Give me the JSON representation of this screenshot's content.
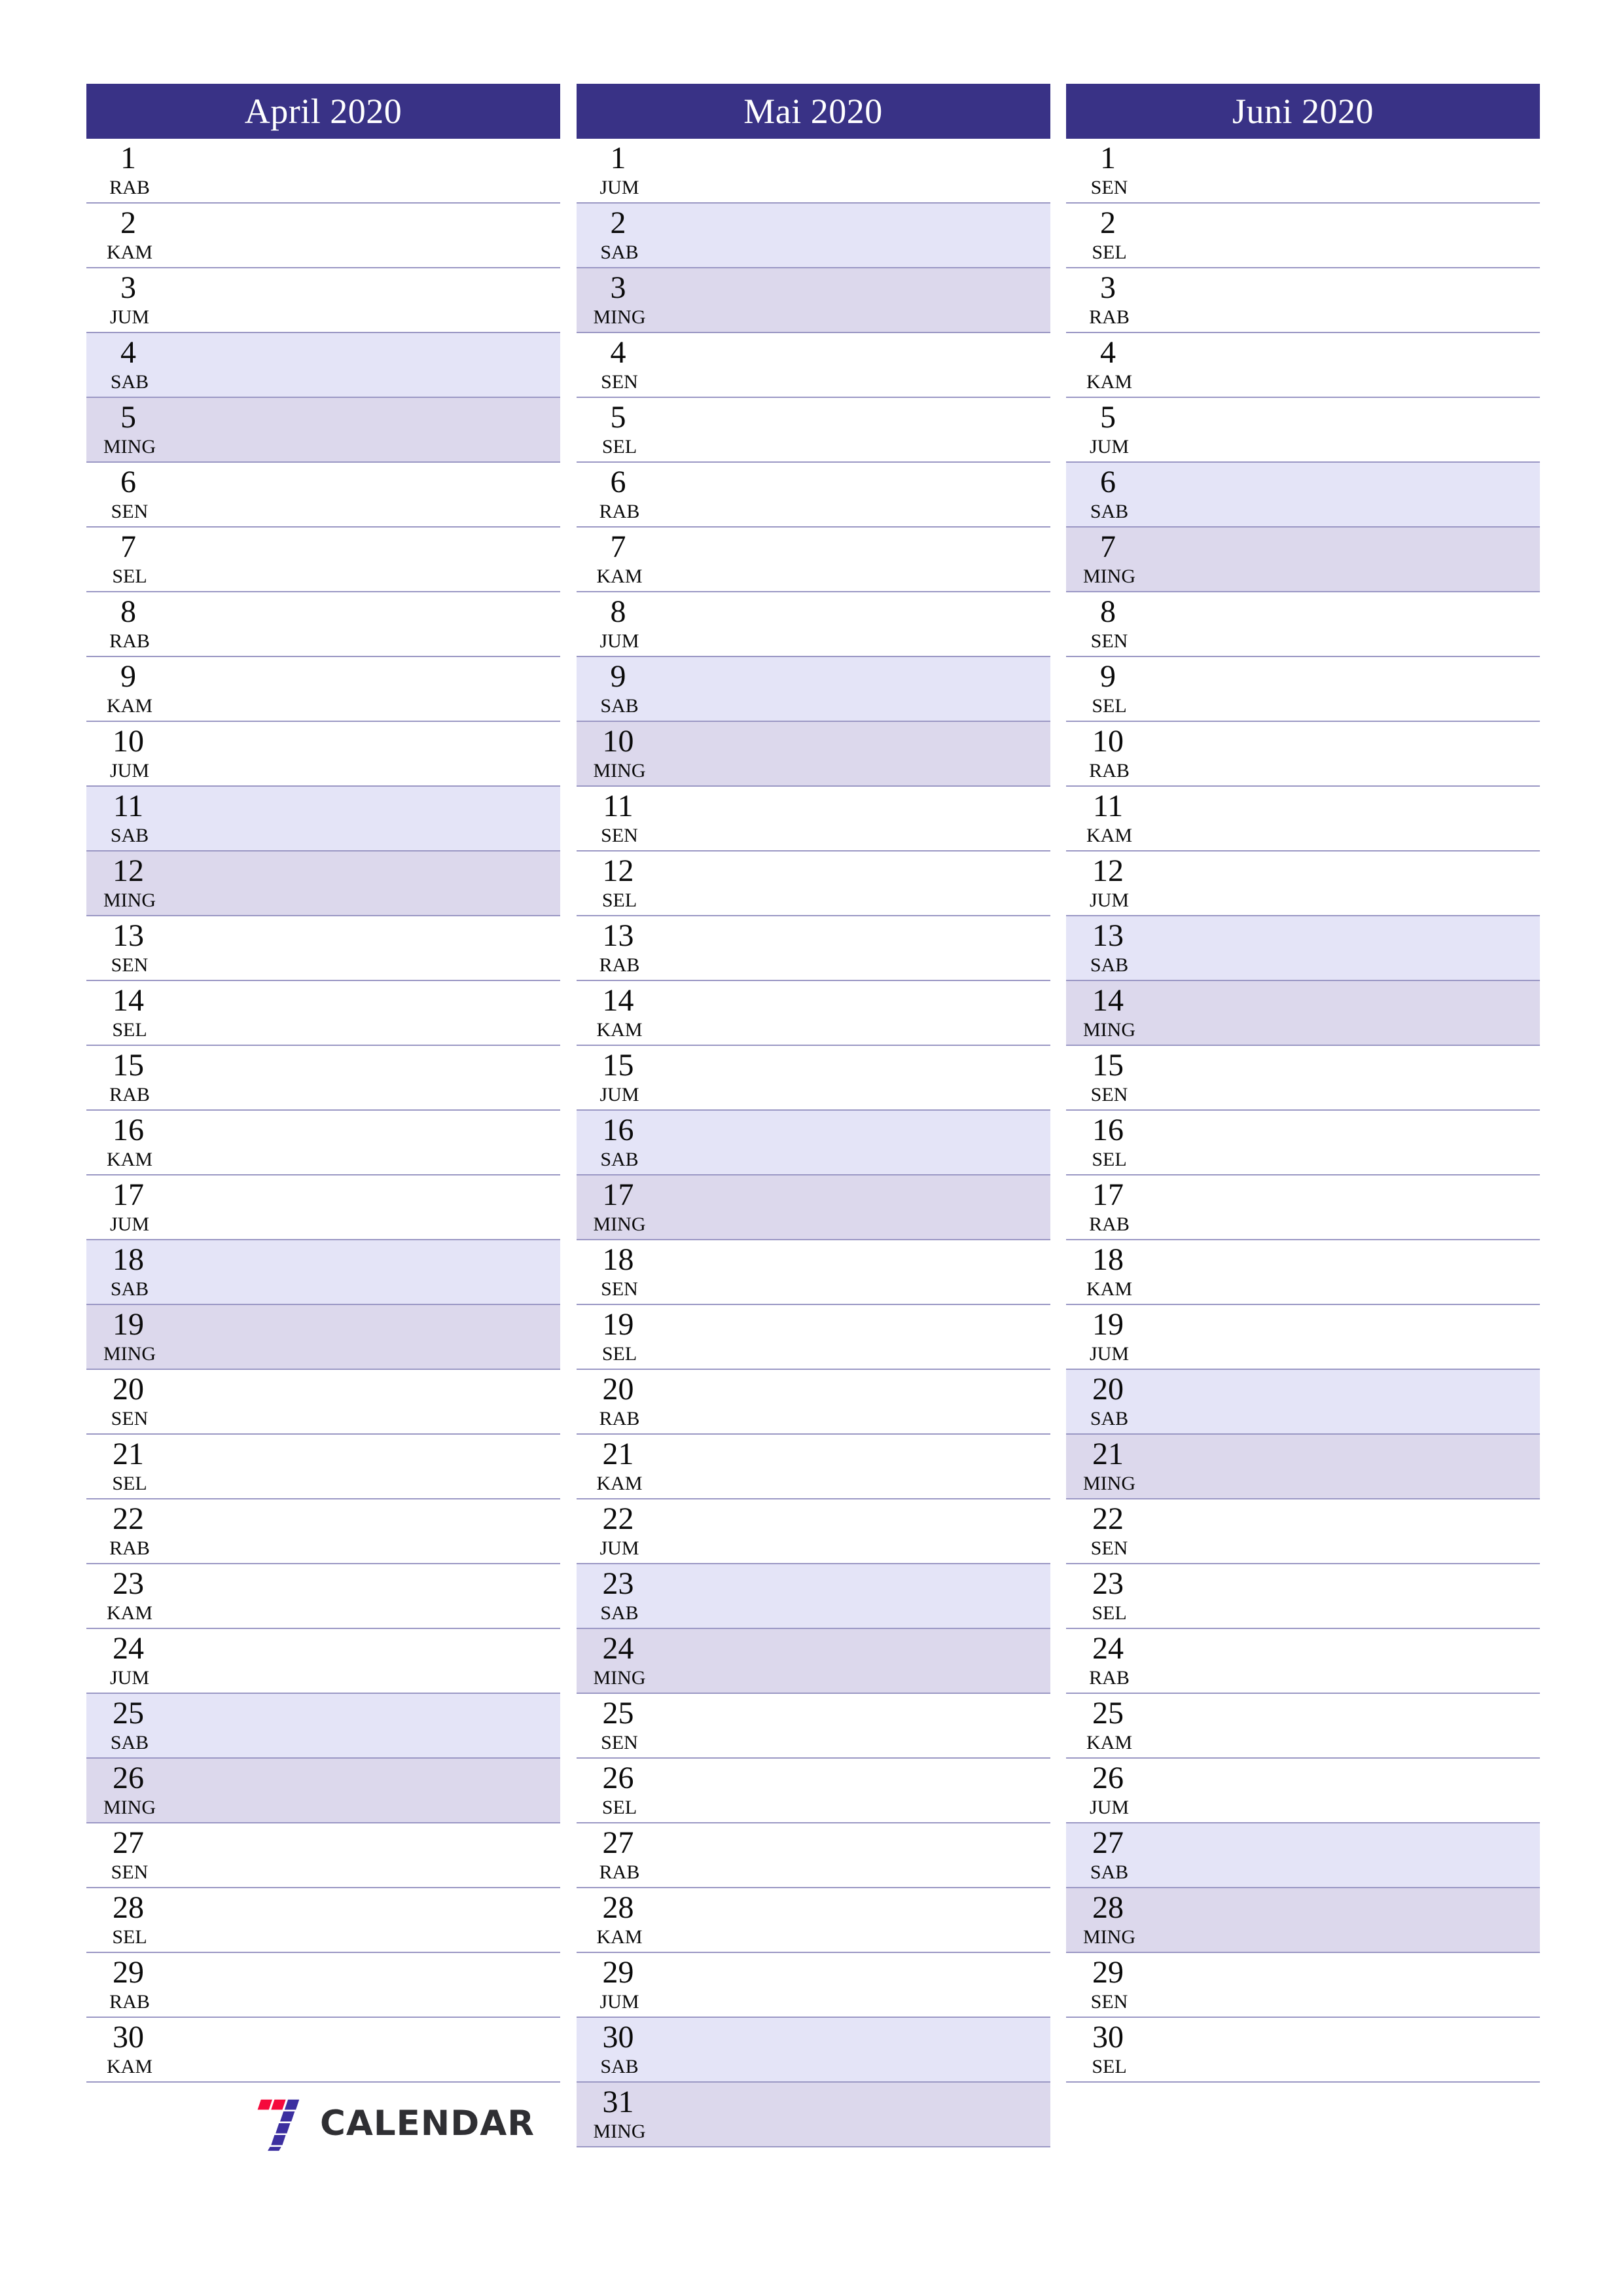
{
  "brand": {
    "name": "CALENDAR",
    "mark_icon": "seven-logo-icon",
    "mark_colors": {
      "red": "#f50a3c",
      "indigo": "#3c2fa0"
    },
    "text_color": "#2f2f33"
  },
  "theme": {
    "header_bg": "#393286",
    "header_text": "#ffffff",
    "saturday_bg": "#e4e4f7",
    "sunday_bg": "#dcd8ec",
    "row_line": "#9a97c4",
    "day_text": "#0a0a0a",
    "page_bg": "#ffffff"
  },
  "page": {
    "orientation": "portrait",
    "columns": 3,
    "locale_weekdays": [
      "SEN",
      "SEL",
      "RAB",
      "KAM",
      "JUM",
      "SAB",
      "MING"
    ]
  },
  "months": [
    {
      "title": "April 2020",
      "days": [
        {
          "num": "1",
          "dow": "RAB"
        },
        {
          "num": "2",
          "dow": "KAM"
        },
        {
          "num": "3",
          "dow": "JUM"
        },
        {
          "num": "4",
          "dow": "SAB"
        },
        {
          "num": "5",
          "dow": "MING"
        },
        {
          "num": "6",
          "dow": "SEN"
        },
        {
          "num": "7",
          "dow": "SEL"
        },
        {
          "num": "8",
          "dow": "RAB"
        },
        {
          "num": "9",
          "dow": "KAM"
        },
        {
          "num": "10",
          "dow": "JUM"
        },
        {
          "num": "11",
          "dow": "SAB"
        },
        {
          "num": "12",
          "dow": "MING"
        },
        {
          "num": "13",
          "dow": "SEN"
        },
        {
          "num": "14",
          "dow": "SEL"
        },
        {
          "num": "15",
          "dow": "RAB"
        },
        {
          "num": "16",
          "dow": "KAM"
        },
        {
          "num": "17",
          "dow": "JUM"
        },
        {
          "num": "18",
          "dow": "SAB"
        },
        {
          "num": "19",
          "dow": "MING"
        },
        {
          "num": "20",
          "dow": "SEN"
        },
        {
          "num": "21",
          "dow": "SEL"
        },
        {
          "num": "22",
          "dow": "RAB"
        },
        {
          "num": "23",
          "dow": "KAM"
        },
        {
          "num": "24",
          "dow": "JUM"
        },
        {
          "num": "25",
          "dow": "SAB"
        },
        {
          "num": "26",
          "dow": "MING"
        },
        {
          "num": "27",
          "dow": "SEN"
        },
        {
          "num": "28",
          "dow": "SEL"
        },
        {
          "num": "29",
          "dow": "RAB"
        },
        {
          "num": "30",
          "dow": "KAM"
        }
      ]
    },
    {
      "title": "Mai 2020",
      "days": [
        {
          "num": "1",
          "dow": "JUM"
        },
        {
          "num": "2",
          "dow": "SAB"
        },
        {
          "num": "3",
          "dow": "MING"
        },
        {
          "num": "4",
          "dow": "SEN"
        },
        {
          "num": "5",
          "dow": "SEL"
        },
        {
          "num": "6",
          "dow": "RAB"
        },
        {
          "num": "7",
          "dow": "KAM"
        },
        {
          "num": "8",
          "dow": "JUM"
        },
        {
          "num": "9",
          "dow": "SAB"
        },
        {
          "num": "10",
          "dow": "MING"
        },
        {
          "num": "11",
          "dow": "SEN"
        },
        {
          "num": "12",
          "dow": "SEL"
        },
        {
          "num": "13",
          "dow": "RAB"
        },
        {
          "num": "14",
          "dow": "KAM"
        },
        {
          "num": "15",
          "dow": "JUM"
        },
        {
          "num": "16",
          "dow": "SAB"
        },
        {
          "num": "17",
          "dow": "MING"
        },
        {
          "num": "18",
          "dow": "SEN"
        },
        {
          "num": "19",
          "dow": "SEL"
        },
        {
          "num": "20",
          "dow": "RAB"
        },
        {
          "num": "21",
          "dow": "KAM"
        },
        {
          "num": "22",
          "dow": "JUM"
        },
        {
          "num": "23",
          "dow": "SAB"
        },
        {
          "num": "24",
          "dow": "MING"
        },
        {
          "num": "25",
          "dow": "SEN"
        },
        {
          "num": "26",
          "dow": "SEL"
        },
        {
          "num": "27",
          "dow": "RAB"
        },
        {
          "num": "28",
          "dow": "KAM"
        },
        {
          "num": "29",
          "dow": "JUM"
        },
        {
          "num": "30",
          "dow": "SAB"
        },
        {
          "num": "31",
          "dow": "MING"
        }
      ]
    },
    {
      "title": "Juni 2020",
      "days": [
        {
          "num": "1",
          "dow": "SEN"
        },
        {
          "num": "2",
          "dow": "SEL"
        },
        {
          "num": "3",
          "dow": "RAB"
        },
        {
          "num": "4",
          "dow": "KAM"
        },
        {
          "num": "5",
          "dow": "JUM"
        },
        {
          "num": "6",
          "dow": "SAB"
        },
        {
          "num": "7",
          "dow": "MING"
        },
        {
          "num": "8",
          "dow": "SEN"
        },
        {
          "num": "9",
          "dow": "SEL"
        },
        {
          "num": "10",
          "dow": "RAB"
        },
        {
          "num": "11",
          "dow": "KAM"
        },
        {
          "num": "12",
          "dow": "JUM"
        },
        {
          "num": "13",
          "dow": "SAB"
        },
        {
          "num": "14",
          "dow": "MING"
        },
        {
          "num": "15",
          "dow": "SEN"
        },
        {
          "num": "16",
          "dow": "SEL"
        },
        {
          "num": "17",
          "dow": "RAB"
        },
        {
          "num": "18",
          "dow": "KAM"
        },
        {
          "num": "19",
          "dow": "JUM"
        },
        {
          "num": "20",
          "dow": "SAB"
        },
        {
          "num": "21",
          "dow": "MING"
        },
        {
          "num": "22",
          "dow": "SEN"
        },
        {
          "num": "23",
          "dow": "SEL"
        },
        {
          "num": "24",
          "dow": "RAB"
        },
        {
          "num": "25",
          "dow": "KAM"
        },
        {
          "num": "26",
          "dow": "JUM"
        },
        {
          "num": "27",
          "dow": "SAB"
        },
        {
          "num": "28",
          "dow": "MING"
        },
        {
          "num": "29",
          "dow": "SEN"
        },
        {
          "num": "30",
          "dow": "SEL"
        }
      ]
    }
  ]
}
